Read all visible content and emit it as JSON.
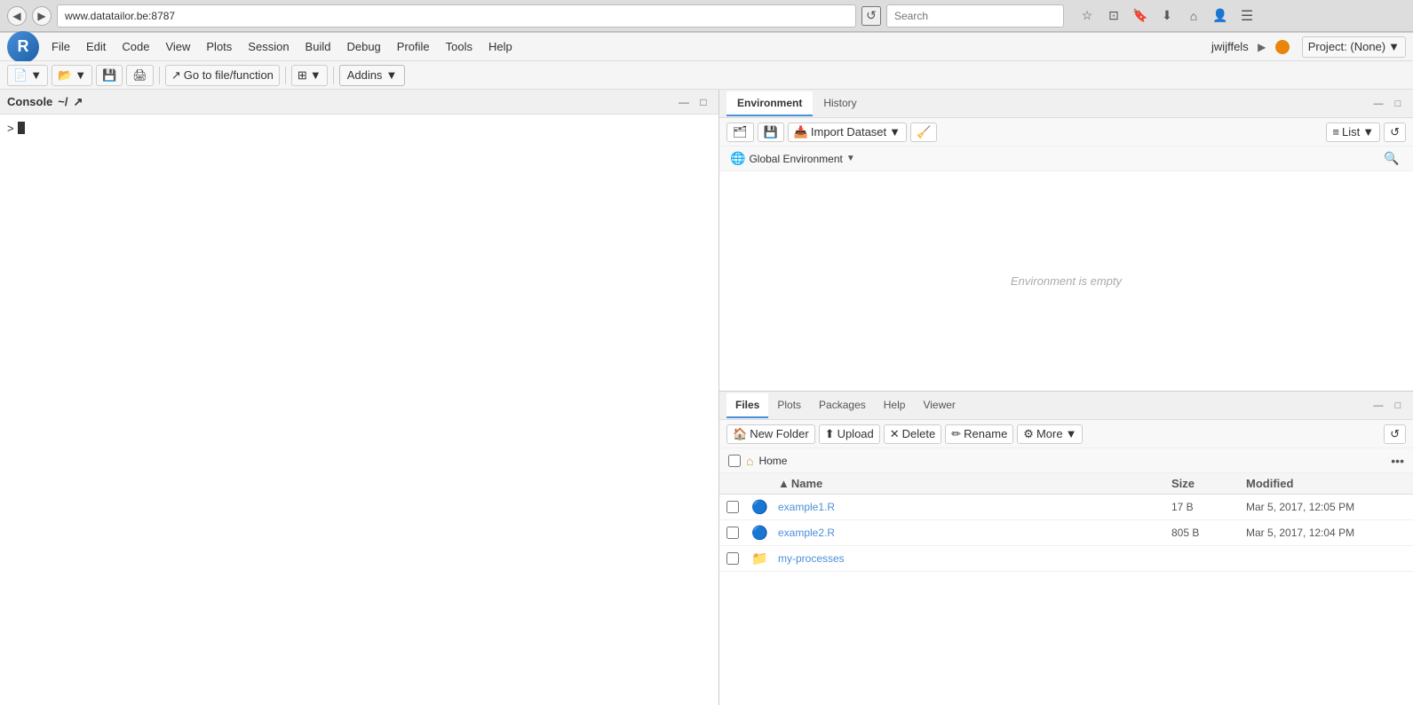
{
  "browser": {
    "url": "www.datatailor.be:8787",
    "search_placeholder": "Search",
    "back_btn": "◀",
    "forward_btn": "▶",
    "refresh_btn": "↺"
  },
  "menu": {
    "r_logo": "R",
    "items": [
      "File",
      "Edit",
      "Code",
      "View",
      "Plots",
      "Session",
      "Build",
      "Debug",
      "Profile",
      "Tools",
      "Help"
    ],
    "user_name": "jwijffels",
    "project_label": "Project: (None)"
  },
  "toolbar": {
    "go_to_file_placeholder": "Go to file/function",
    "addins_label": "Addins",
    "minimize_label": "—",
    "maximize_label": "□"
  },
  "console": {
    "title": "Console",
    "subtitle": "~/",
    "empty_text": ""
  },
  "environment": {
    "tab1": "Environment",
    "tab2": "History",
    "import_dataset_label": "Import Dataset",
    "list_label": "List",
    "global_env_label": "Global Environment",
    "empty_message": "Environment is empty"
  },
  "files": {
    "tabs": [
      "Files",
      "Plots",
      "Packages",
      "Help",
      "Viewer"
    ],
    "active_tab": "Files",
    "toolbar_buttons": [
      "New Folder",
      "Upload",
      "Delete",
      "Rename",
      "More"
    ],
    "path_label": "Home",
    "columns": {
      "name": "Name",
      "size": "Size",
      "modified": "Modified"
    },
    "rows": [
      {
        "name": "example1.R",
        "size": "17 B",
        "modified": "Mar 5, 2017, 12:05 PM",
        "type": "r-file",
        "icon": "📄"
      },
      {
        "name": "example2.R",
        "size": "805 B",
        "modified": "Mar 5, 2017, 12:04 PM",
        "type": "r-file",
        "icon": "📄"
      },
      {
        "name": "my-processes",
        "size": "",
        "modified": "",
        "type": "folder",
        "icon": "📁"
      }
    ]
  }
}
